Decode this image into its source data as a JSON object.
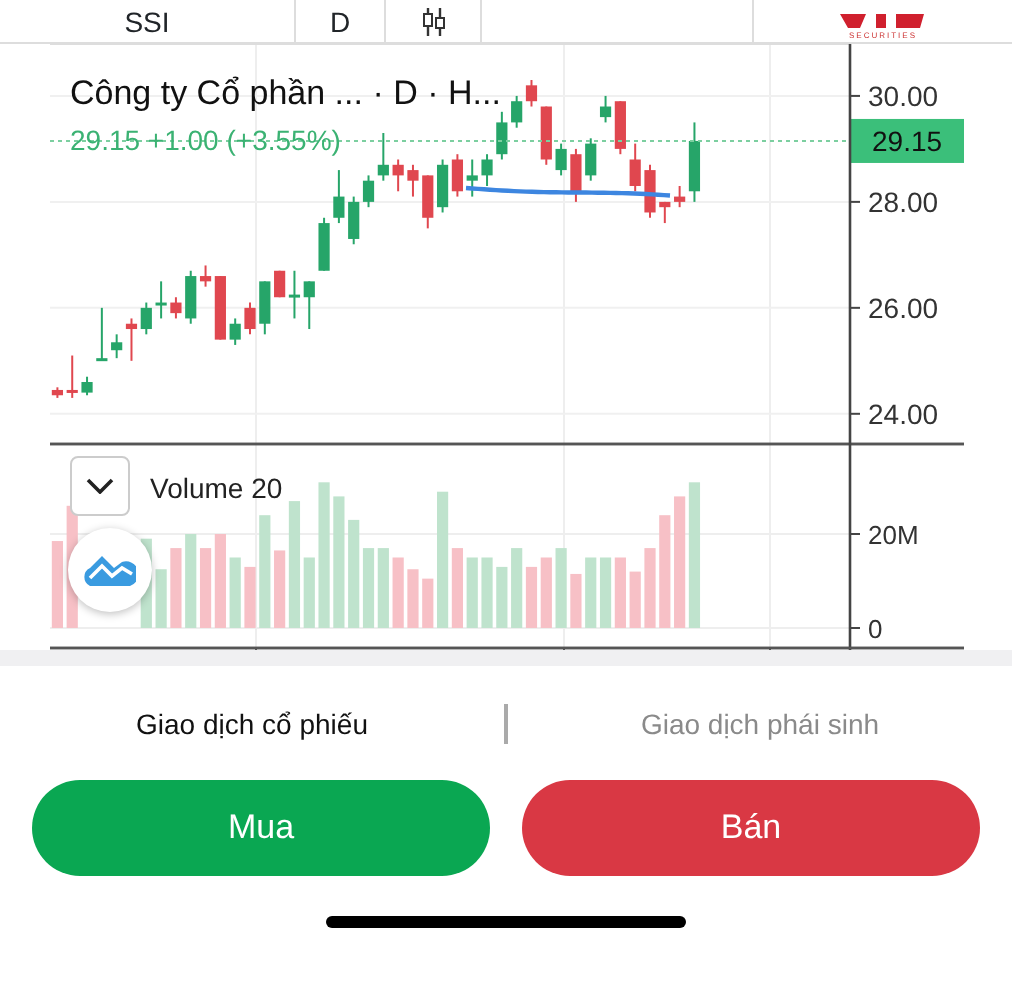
{
  "toolbar": {
    "symbol": "SSI",
    "interval": "D",
    "logo_caption": "SECURITIES"
  },
  "price_chart": {
    "legend": "Công ty Cổ phần ... · D · H...",
    "quote": "29.15 +1.00 (+3.55%)",
    "last_price": "29.15",
    "chart_data": {
      "type": "candlestick",
      "categories": [
        null,
        null,
        null,
        null,
        null,
        null,
        null,
        null,
        null,
        null,
        null,
        null,
        null,
        null,
        null,
        null,
        null,
        null,
        null,
        null,
        null,
        null,
        null,
        null,
        null,
        null,
        null,
        null,
        null,
        null,
        null,
        null,
        null,
        null,
        null,
        null,
        null,
        null,
        null,
        null,
        null,
        null,
        null,
        null,
        null,
        null,
        null,
        null,
        null,
        null,
        null,
        null,
        null,
        null
      ],
      "grid": true,
      "ylim": [
        23.43,
        30.98
      ],
      "yticks": [
        {
          "value": 30,
          "label": "30.00"
        },
        {
          "value": 28,
          "label": "28.00"
        },
        {
          "value": 26,
          "label": "26.00"
        },
        {
          "value": 24,
          "label": "24.00"
        }
      ],
      "ohlc": [
        [
          24.45,
          24.5,
          24.3,
          24.35
        ],
        [
          24.45,
          25.1,
          24.3,
          24.4
        ],
        [
          24.4,
          24.7,
          24.35,
          24.6
        ],
        [
          25.0,
          26.0,
          25.0,
          25.05
        ],
        [
          25.2,
          25.5,
          25.05,
          25.35
        ],
        [
          25.7,
          25.8,
          25.0,
          25.6
        ],
        [
          25.6,
          26.1,
          25.5,
          26.0
        ],
        [
          26.1,
          26.5,
          25.8,
          26.1
        ],
        [
          26.1,
          26.2,
          25.8,
          25.9
        ],
        [
          25.8,
          26.7,
          25.7,
          26.6
        ],
        [
          26.6,
          26.8,
          26.4,
          26.5
        ],
        [
          26.6,
          26.6,
          25.4,
          25.4
        ],
        [
          25.4,
          25.8,
          25.3,
          25.7
        ],
        [
          26.0,
          26.1,
          25.5,
          25.6
        ],
        [
          25.7,
          26.5,
          25.5,
          26.5
        ],
        [
          26.7,
          26.7,
          26.2,
          26.2
        ],
        [
          26.2,
          26.7,
          25.8,
          26.25
        ],
        [
          26.2,
          26.5,
          25.6,
          26.5
        ],
        [
          26.7,
          27.7,
          26.7,
          27.6
        ],
        [
          27.7,
          28.6,
          27.6,
          28.1
        ],
        [
          27.3,
          28.1,
          27.2,
          28.0
        ],
        [
          28.0,
          28.5,
          27.9,
          28.4
        ],
        [
          28.5,
          29.3,
          28.4,
          28.7
        ],
        [
          28.7,
          28.8,
          28.2,
          28.5
        ],
        [
          28.6,
          28.7,
          28.1,
          28.4
        ],
        [
          28.5,
          28.5,
          27.5,
          27.7
        ],
        [
          27.9,
          28.8,
          27.8,
          28.7
        ],
        [
          28.8,
          28.9,
          28.1,
          28.2
        ],
        [
          28.4,
          28.8,
          28.1,
          28.5
        ],
        [
          28.5,
          28.9,
          28.3,
          28.8
        ],
        [
          28.9,
          29.7,
          28.8,
          29.5
        ],
        [
          29.5,
          30.0,
          29.4,
          29.9
        ],
        [
          30.2,
          30.3,
          29.8,
          29.9
        ],
        [
          29.8,
          29.8,
          28.7,
          28.8
        ],
        [
          28.6,
          29.1,
          28.5,
          29.0
        ],
        [
          28.9,
          29.0,
          28.0,
          28.2
        ],
        [
          28.5,
          29.2,
          28.4,
          29.1
        ],
        [
          29.6,
          30.0,
          29.5,
          29.8
        ],
        [
          29.9,
          29.9,
          28.9,
          29.0
        ],
        [
          28.8,
          29.1,
          28.2,
          28.3
        ],
        [
          28.6,
          28.7,
          27.7,
          27.8
        ],
        [
          28.0,
          28.0,
          27.6,
          27.9
        ],
        [
          28.1,
          28.3,
          27.9,
          28.0
        ],
        [
          28.2,
          29.5,
          28.0,
          29.15
        ],
        null,
        null,
        null,
        null,
        null,
        null,
        null,
        null,
        null,
        null
      ]
    }
  },
  "volume_pane": {
    "chart_data": {
      "type": "bar",
      "title": "Volume 20",
      "categories": [
        null,
        null,
        null,
        null,
        null,
        null,
        null,
        null,
        null,
        null,
        null,
        null,
        null,
        null,
        null,
        null,
        null,
        null,
        null,
        null,
        null,
        null,
        null,
        null,
        null,
        null,
        null,
        null,
        null,
        null,
        null,
        null,
        null,
        null,
        null,
        null,
        null,
        null,
        null,
        null,
        null,
        null,
        null,
        null,
        null,
        null,
        null,
        null,
        null,
        null,
        null,
        null,
        null,
        null
      ],
      "grid": true,
      "ylim": [
        -4.26,
        39.15
      ],
      "yticks": [
        {
          "value": 0,
          "label": "0"
        },
        {
          "value": 20,
          "label": "20M"
        }
      ],
      "series": [
        {
          "values": [
            18.5,
            26,
            null,
            null,
            null,
            null,
            19,
            12.5,
            17,
            20,
            17,
            20,
            15,
            13,
            24,
            16.5,
            27,
            15,
            31,
            28,
            23,
            17,
            17,
            15,
            12.5,
            10.5,
            29,
            17,
            15,
            15,
            13,
            17,
            13,
            15,
            17,
            11.5,
            15,
            15,
            15,
            12,
            17,
            24,
            28,
            31,
            null,
            null,
            null,
            null,
            null,
            null,
            null,
            null,
            null,
            null
          ]
        }
      ]
    }
  },
  "tabs": [
    {
      "label": "Giao dịch cổ phiếu",
      "selected": true
    },
    {
      "label": "Giao dịch phái sinh",
      "selected": false
    }
  ],
  "buttons": [
    {
      "label": "Mua",
      "kind": "buy"
    },
    {
      "label": "Bán",
      "kind": "sell"
    }
  ]
}
